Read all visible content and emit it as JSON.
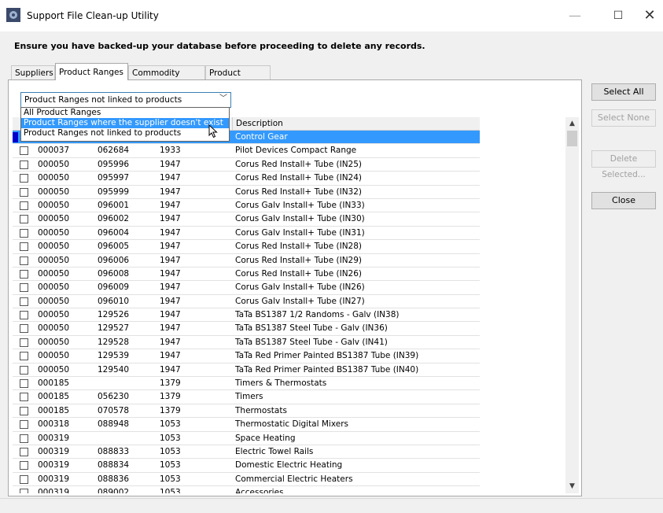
{
  "window": {
    "title": "Support File Clean-up Utility",
    "minimize": "—",
    "maximize": "☐",
    "close": "✕"
  },
  "warning": "Ensure you have backed-up your database before proceeding to delete any records.",
  "tabs": [
    {
      "label": "Suppliers",
      "active": false
    },
    {
      "label": "Product Ranges",
      "active": true
    },
    {
      "label": "Commodity Codes",
      "active": false
    },
    {
      "label": "Product Groups",
      "active": false
    }
  ],
  "filter": {
    "selected": "Product Ranges not linked to products",
    "options": [
      "All Product Ranges",
      "Product Ranges where the supplier doesn't exist",
      "Product Ranges not linked to products"
    ],
    "highlighted_index": 1
  },
  "grid": {
    "header_description": "Description",
    "rows": [
      {
        "c1": "",
        "c2": "",
        "c3": "",
        "desc": "Control Gear",
        "selected": true
      },
      {
        "c1": "000037",
        "c2": "062684",
        "c3": "1933",
        "desc": "Pilot Devices Compact Range"
      },
      {
        "c1": "000050",
        "c2": "095996",
        "c3": "1947",
        "desc": "Corus Red Install+ Tube (IN25)"
      },
      {
        "c1": "000050",
        "c2": "095997",
        "c3": "1947",
        "desc": "Corus Red Install+ Tube (IN24)"
      },
      {
        "c1": "000050",
        "c2": "095999",
        "c3": "1947",
        "desc": "Corus Red Install+ Tube (IN32)"
      },
      {
        "c1": "000050",
        "c2": "096001",
        "c3": "1947",
        "desc": "Corus Galv Install+ Tube (IN33)"
      },
      {
        "c1": "000050",
        "c2": "096002",
        "c3": "1947",
        "desc": "Corus Galv Install+ Tube (IN30)"
      },
      {
        "c1": "000050",
        "c2": "096004",
        "c3": "1947",
        "desc": "Corus Galv Install+ Tube (IN31)"
      },
      {
        "c1": "000050",
        "c2": "096005",
        "c3": "1947",
        "desc": "Corus Red Install+ Tube (IN28)"
      },
      {
        "c1": "000050",
        "c2": "096006",
        "c3": "1947",
        "desc": "Corus Red Install+ Tube (IN29)"
      },
      {
        "c1": "000050",
        "c2": "096008",
        "c3": "1947",
        "desc": "Corus Red Install+ Tube (IN26)"
      },
      {
        "c1": "000050",
        "c2": "096009",
        "c3": "1947",
        "desc": "Corus Galv Install+ Tube (IN26)"
      },
      {
        "c1": "000050",
        "c2": "096010",
        "c3": "1947",
        "desc": "Corus Galv Install+ Tube (IN27)"
      },
      {
        "c1": "000050",
        "c2": "129526",
        "c3": "1947",
        "desc": "TaTa BS1387 1/2 Randoms - Galv (IN38)"
      },
      {
        "c1": "000050",
        "c2": "129527",
        "c3": "1947",
        "desc": "TaTa BS1387 Steel Tube - Galv (IN36)"
      },
      {
        "c1": "000050",
        "c2": "129528",
        "c3": "1947",
        "desc": "TaTa BS1387 Steel Tube - Galv (IN41)"
      },
      {
        "c1": "000050",
        "c2": "129539",
        "c3": "1947",
        "desc": "TaTa Red Primer Painted BS1387 Tube (IN39)"
      },
      {
        "c1": "000050",
        "c2": "129540",
        "c3": "1947",
        "desc": "TaTa Red Primer Painted BS1387 Tube (IN40)"
      },
      {
        "c1": "000185",
        "c2": "",
        "c3": "1379",
        "desc": "Timers & Thermostats"
      },
      {
        "c1": "000185",
        "c2": "056230",
        "c3": "1379",
        "desc": "Timers"
      },
      {
        "c1": "000185",
        "c2": "070578",
        "c3": "1379",
        "desc": "Thermostats"
      },
      {
        "c1": "000318",
        "c2": "088948",
        "c3": "1053",
        "desc": "Thermostatic Digital Mixers"
      },
      {
        "c1": "000319",
        "c2": "",
        "c3": "1053",
        "desc": "Space Heating"
      },
      {
        "c1": "000319",
        "c2": "088833",
        "c3": "1053",
        "desc": "Electric Towel Rails"
      },
      {
        "c1": "000319",
        "c2": "088834",
        "c3": "1053",
        "desc": "Domestic Electric Heating"
      },
      {
        "c1": "000319",
        "c2": "088836",
        "c3": "1053",
        "desc": "Commercial Electric Heaters"
      },
      {
        "c1": "000319",
        "c2": "089002",
        "c3": "1053",
        "desc": "Accessories"
      }
    ]
  },
  "buttons": {
    "select_all": "Select All",
    "select_none": "Select None",
    "delete_selected": "Delete Selected...",
    "close": "Close"
  },
  "colors": {
    "selection": "#3399ff",
    "accent_border": "#3c7fb1"
  },
  "icons": {
    "app": "app-gear-icon",
    "dropdown": "chevron-down-icon",
    "scroll_up": "chevron-up-icon",
    "scroll_down": "chevron-down-icon",
    "cursor": "mouse-pointer-icon"
  }
}
